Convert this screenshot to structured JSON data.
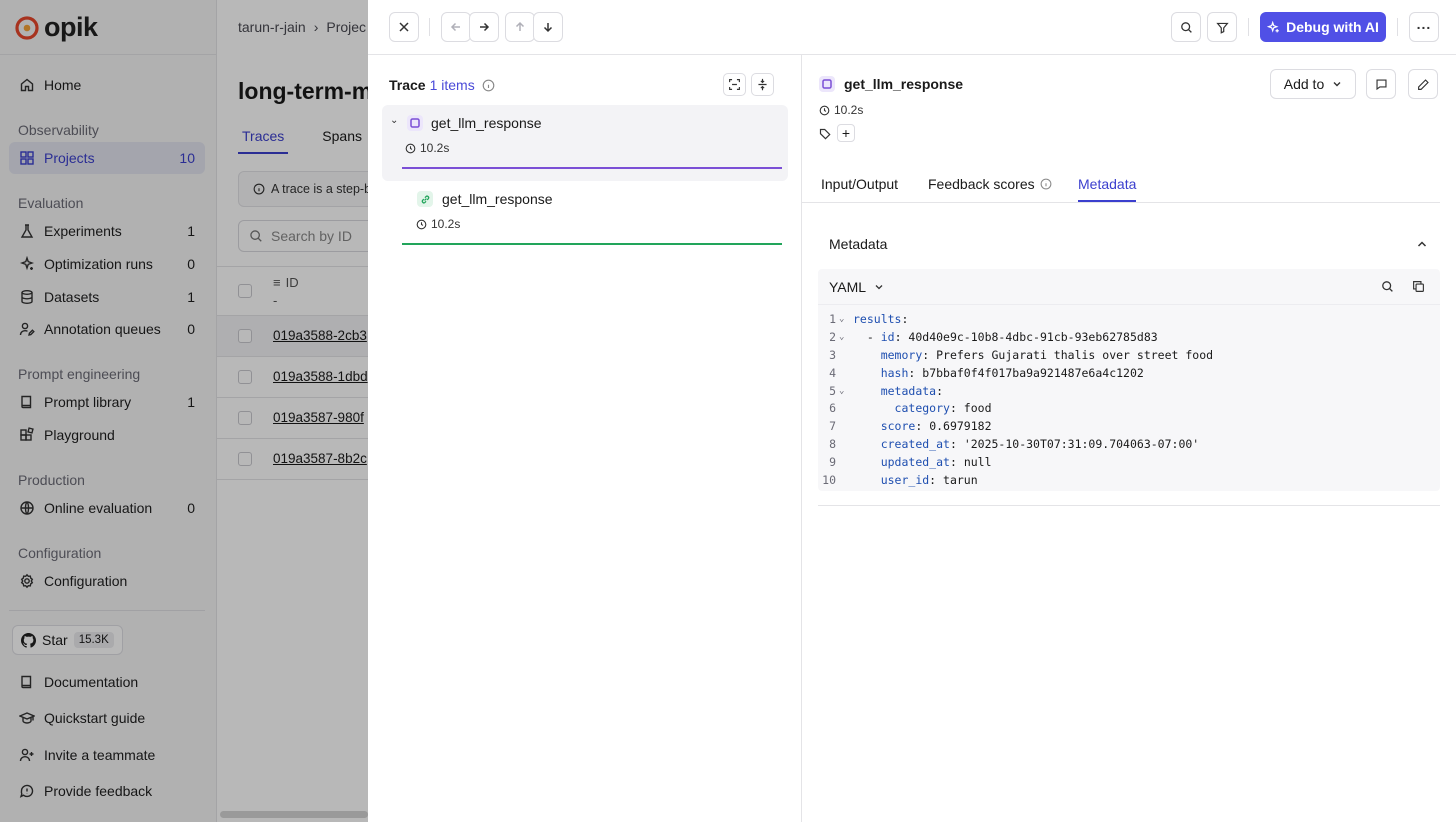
{
  "brand": {
    "name": "opik",
    "accent": "#5050e6",
    "logo_color": "#e8472c"
  },
  "sidebar": {
    "home": {
      "label": "Home",
      "icon": "home-icon"
    },
    "sections": [
      {
        "title": "Observability"
      },
      {
        "title": "Evaluation"
      },
      {
        "title": "Prompt engineering"
      },
      {
        "title": "Production"
      },
      {
        "title": "Configuration"
      }
    ],
    "items": [
      {
        "label": "Projects",
        "count": "10",
        "icon": "grid-icon"
      },
      {
        "label": "Experiments",
        "count": "1",
        "icon": "flask-icon"
      },
      {
        "label": "Optimization runs",
        "count": "0",
        "icon": "sparkle-icon"
      },
      {
        "label": "Datasets",
        "count": "1",
        "icon": "database-icon"
      },
      {
        "label": "Annotation queues",
        "count": "0",
        "icon": "user-edit-icon"
      },
      {
        "label": "Prompt library",
        "count": "1",
        "icon": "book-icon"
      },
      {
        "label": "Playground",
        "count": "",
        "icon": "blocks-icon"
      },
      {
        "label": "Online evaluation",
        "count": "0",
        "icon": "globe-icon"
      },
      {
        "label": "Configuration",
        "count": "",
        "icon": "gear-icon"
      }
    ],
    "star": {
      "label": "Star",
      "count": "15.3K"
    },
    "footer": [
      {
        "label": "Documentation",
        "icon": "book-icon"
      },
      {
        "label": "Quickstart guide",
        "icon": "graduation-cap-icon"
      },
      {
        "label": "Invite a teammate",
        "icon": "user-plus-icon"
      },
      {
        "label": "Provide feedback",
        "icon": "message-icon"
      }
    ]
  },
  "main": {
    "breadcrumb": [
      "tarun-r-jain",
      "Projec"
    ],
    "title": "long-term-m",
    "tabs": [
      "Traces",
      "Spans"
    ],
    "info": "A trace is a step-by",
    "search_placeholder": "Search by ID",
    "table": {
      "id_header": "ID",
      "id_sub": "-",
      "rows": [
        "019a3588-2cb3",
        "019a3588-1dbd",
        "019a3587-980f",
        "019a3587-8b2c"
      ]
    }
  },
  "panel": {
    "debug_label": "Debug with AI",
    "trace": {
      "label": "Trace",
      "items": "1 items",
      "spans": [
        {
          "name": "get_llm_response",
          "duration": "10.2s",
          "color": "#7b4fd6"
        },
        {
          "name": "get_llm_response",
          "duration": "10.2s",
          "color": "#22a55b"
        }
      ]
    },
    "detail": {
      "title": "get_llm_response",
      "duration": "10.2s",
      "add_to": "Add to",
      "tabs": [
        "Input/Output",
        "Feedback scores",
        "Metadata"
      ],
      "section": "Metadata",
      "format": "YAML",
      "lines": [
        {
          "n": "1",
          "key": "results",
          "val": "",
          "indent": "",
          "fold": true,
          "dash": false
        },
        {
          "n": "2",
          "key": "id",
          "val": "40d40e9c-10b8-4dbc-91cb-93eb62785d83",
          "indent": "  ",
          "fold": true,
          "dash": true
        },
        {
          "n": "3",
          "key": "memory",
          "val": "Prefers Gujarati thalis over street food",
          "indent": "    ",
          "fold": false,
          "dash": false
        },
        {
          "n": "4",
          "key": "hash",
          "val": "b7bbaf0f4f017ba9a921487e6a4c1202",
          "indent": "    ",
          "fold": false,
          "dash": false
        },
        {
          "n": "5",
          "key": "metadata",
          "val": "",
          "indent": "    ",
          "fold": true,
          "dash": false
        },
        {
          "n": "6",
          "key": "category",
          "val": "food",
          "indent": "      ",
          "fold": false,
          "dash": false
        },
        {
          "n": "7",
          "key": "score",
          "val": "0.6979182",
          "indent": "    ",
          "fold": false,
          "dash": false
        },
        {
          "n": "8",
          "key": "created_at",
          "val": "'2025-10-30T07:31:09.704063-07:00'",
          "indent": "    ",
          "fold": false,
          "dash": false
        },
        {
          "n": "9",
          "key": "updated_at",
          "val": "null",
          "indent": "    ",
          "fold": false,
          "dash": false
        },
        {
          "n": "10",
          "key": "user_id",
          "val": "tarun",
          "indent": "    ",
          "fold": false,
          "dash": false
        }
      ]
    }
  }
}
